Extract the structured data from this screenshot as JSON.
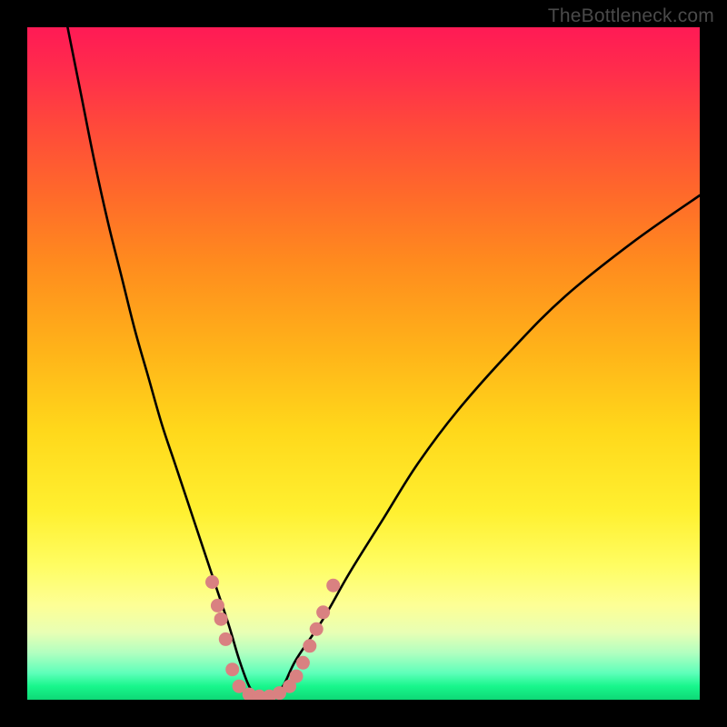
{
  "watermark": "TheBottleneck.com",
  "chart_data": {
    "type": "line",
    "title": "",
    "xlabel": "",
    "ylabel": "",
    "xlim": [
      0,
      100
    ],
    "ylim": [
      0,
      100
    ],
    "grid": false,
    "legend": false,
    "background_gradient": {
      "top_color": "#ff1a55",
      "mid_colors": [
        "#ff8b1e",
        "#ffd81b",
        "#fffd62"
      ],
      "bottom_color": "#0ed876",
      "description": "vertical red→orange→yellow→green"
    },
    "series": [
      {
        "name": "bottleneck-curve",
        "color": "#000000",
        "x": [
          6,
          8,
          10,
          12,
          14,
          16,
          18,
          20,
          22,
          24,
          26,
          28,
          30,
          31.5,
          33,
          34.5,
          36,
          38,
          40,
          44,
          48,
          53,
          58,
          64,
          72,
          80,
          90,
          100
        ],
        "y": [
          100,
          90,
          80,
          71,
          63,
          55,
          48,
          41,
          35,
          29,
          23,
          17,
          11,
          6,
          2,
          0,
          0,
          2,
          6,
          12,
          19,
          27,
          35,
          43,
          52,
          60,
          68,
          75
        ]
      }
    ],
    "markers": {
      "name": "highlighted-points",
      "color": "#d98181",
      "points_xy": [
        [
          27.5,
          17.5
        ],
        [
          28.3,
          14.0
        ],
        [
          28.8,
          12.0
        ],
        [
          29.5,
          9.0
        ],
        [
          30.5,
          4.5
        ],
        [
          31.5,
          2.0
        ],
        [
          33.0,
          0.8
        ],
        [
          34.5,
          0.5
        ],
        [
          36.0,
          0.5
        ],
        [
          37.5,
          1.0
        ],
        [
          39.0,
          2.0
        ],
        [
          40.0,
          3.5
        ],
        [
          41.0,
          5.5
        ],
        [
          42.0,
          8.0
        ],
        [
          43.0,
          10.5
        ],
        [
          44.0,
          13.0
        ],
        [
          45.5,
          17.0
        ]
      ]
    }
  }
}
